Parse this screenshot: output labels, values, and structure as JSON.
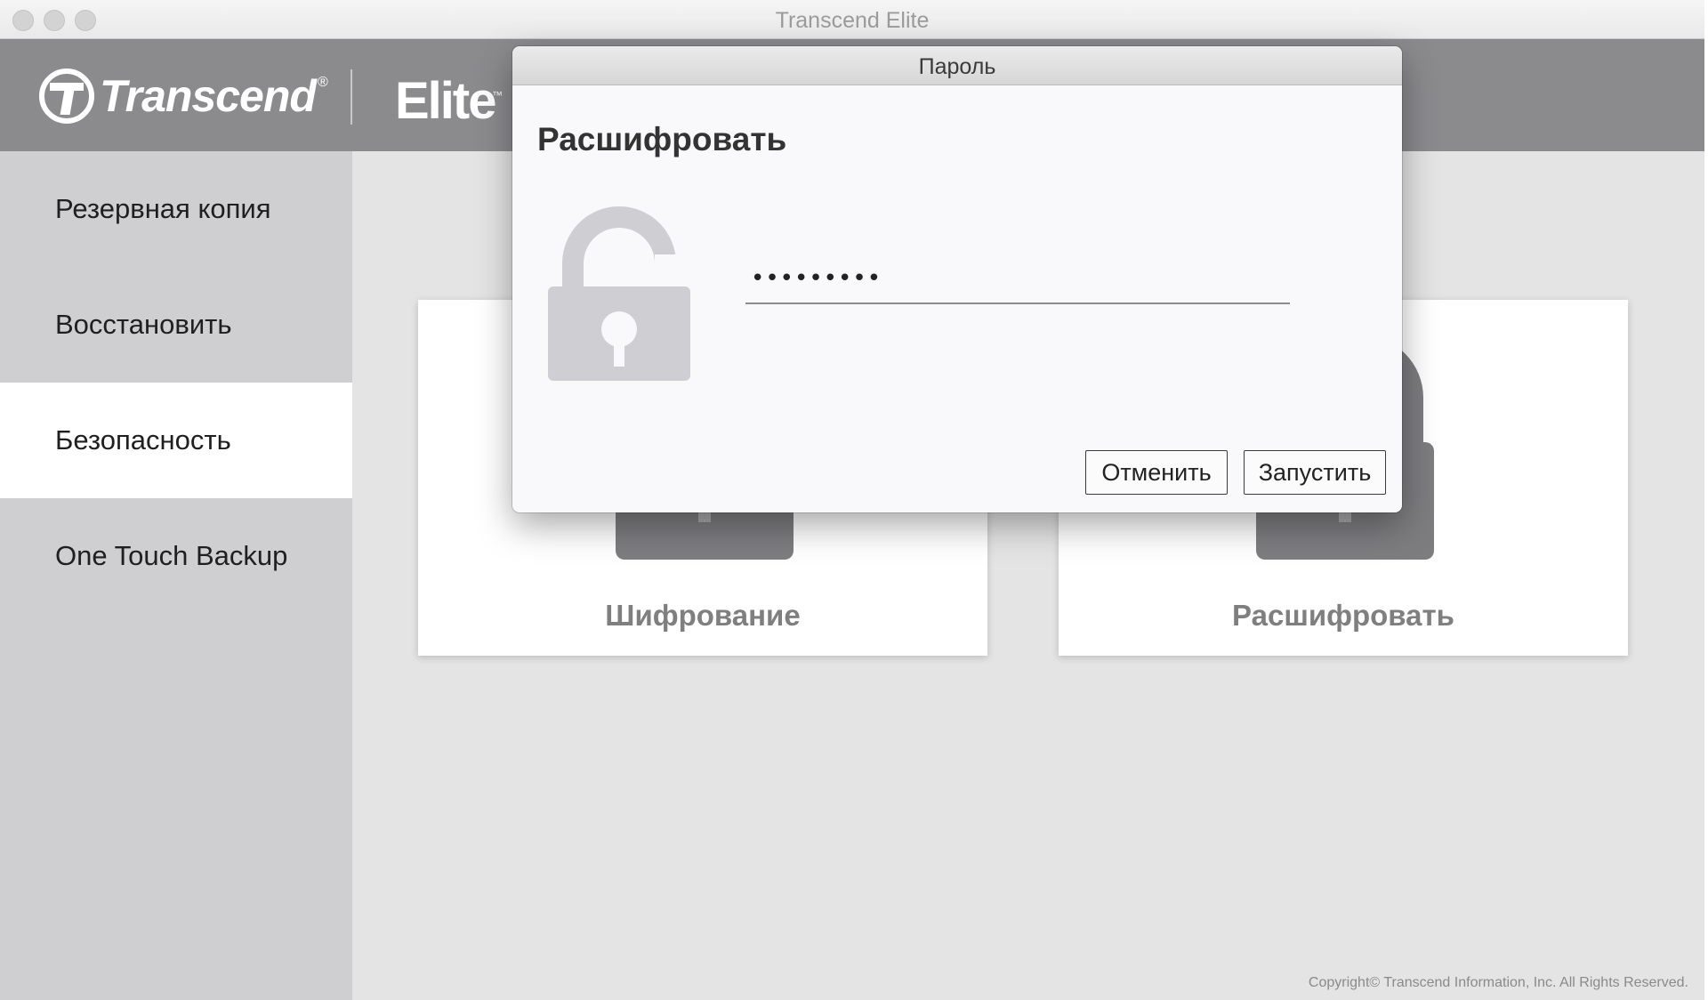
{
  "window": {
    "title": "Transcend Elite"
  },
  "header": {
    "brand": "Transcend",
    "brand_reg": "®",
    "product": "Elite",
    "product_tm": "™"
  },
  "sidebar": {
    "items": [
      {
        "label": "Резервная копия",
        "active": false
      },
      {
        "label": "Восстановить",
        "active": false
      },
      {
        "label": "Безопасность",
        "active": true
      },
      {
        "label": "One Touch Backup",
        "active": false
      }
    ]
  },
  "cards": [
    {
      "label": "Шифрование",
      "icon": "lock-icon"
    },
    {
      "label": "Расшифровать",
      "icon": "unlock-icon"
    }
  ],
  "footer": {
    "copyright": "Copyright© Transcend Information, Inc. All Rights Reserved."
  },
  "dialog": {
    "title": "Пароль",
    "heading": "Расшифровать",
    "icon": "unlocked-padlock-icon",
    "password": {
      "masked_value": "•••••••••",
      "toggle_icon": "eye-icon"
    },
    "buttons": {
      "cancel": "Отменить",
      "start": "Запустить"
    }
  },
  "colors": {
    "header": "#8b8b8e",
    "sidebar": "#cfcfd2",
    "content": "#e4e4e4",
    "dialog": "#f9f8fb"
  }
}
